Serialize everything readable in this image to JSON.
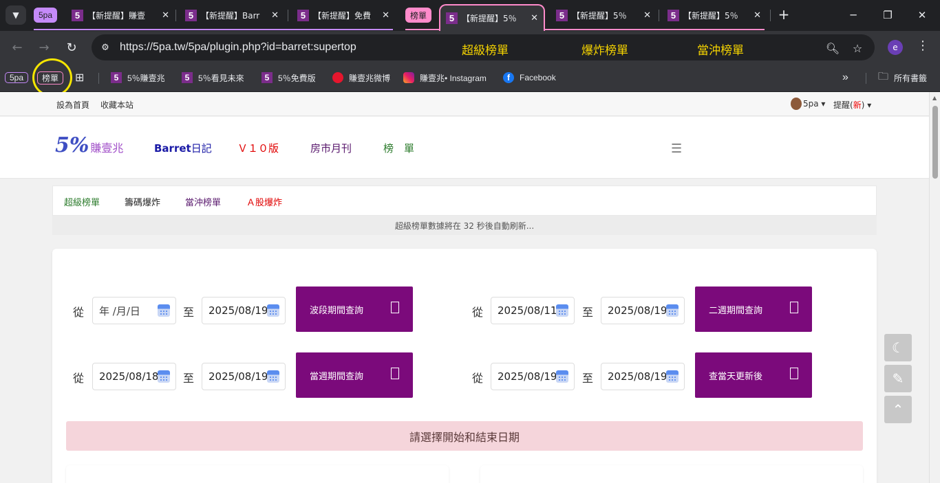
{
  "browser": {
    "tabs": {
      "dropdown_icon": "chevron-down-icon",
      "group1": "5pa",
      "tab1": "【新提醒】賺壹",
      "tab2": "【新提醒】Barr",
      "tab3": "【新提醒】免費",
      "group2": "榜單",
      "tab4": "【新提醒】5％",
      "tab5": "【新提醒】5％",
      "tab6": "【新提醒】5％",
      "close": "✕",
      "new_tab": "+"
    },
    "url": "https://5pa.tw/5pa/plugin.php?id=barret:supertop",
    "overlay_labels": [
      "超級榜單",
      "爆炸榜單",
      "當沖榜單"
    ],
    "profile_letter": "e",
    "bookmarks": {
      "group1": "5pa",
      "group2": "榜單",
      "b1": "5％賺壹兆",
      "b2": "5％看見未來",
      "b3": "5％免費版",
      "b4": "賺壹兆微博",
      "b5": "賺壹兆• Instagram",
      "b6": "Facebook",
      "all": "所有書籤",
      "more": "»"
    }
  },
  "page": {
    "topbar": {
      "set_home": "設為首頁",
      "bookmark_site": "收藏本站",
      "user": "5pa",
      "remind_prefix": "提醒(",
      "remind_new": "新",
      "remind_suffix": ")"
    },
    "logo": {
      "num": "5%",
      "text": "賺壹兆"
    },
    "nav": {
      "diary_a": "Barret",
      "diary_b": "日記",
      "v10": "Ｖ１０版",
      "monthly": "房市月刊",
      "ranking": "榜　單"
    },
    "subtabs": [
      "超級榜單",
      "籌碼爆炸",
      "當沖榜單",
      "Ａ股爆炸"
    ],
    "notice": "超級榜單數據將在 32 秒後自動刷新...",
    "form": {
      "from_label": "從",
      "to_label": "至",
      "rows": [
        {
          "from": "年 /月/日",
          "to": "2025/08/19",
          "button": "波段期間查詢"
        },
        {
          "from": "2025/08/11",
          "to": "2025/08/19",
          "button": "二週期間查詢"
        },
        {
          "from": "2025/08/18",
          "to": "2025/08/19",
          "button": "當週期間查詢"
        },
        {
          "from": "2025/08/19",
          "to": "2025/08/19",
          "button": "查當天更新後"
        }
      ]
    },
    "alert": "請選擇開始和結束日期"
  },
  "colors": {
    "button_purple": "#7b0a7b",
    "overlay_yellow": "#f5d300",
    "alert_bg": "#f5d5db"
  }
}
